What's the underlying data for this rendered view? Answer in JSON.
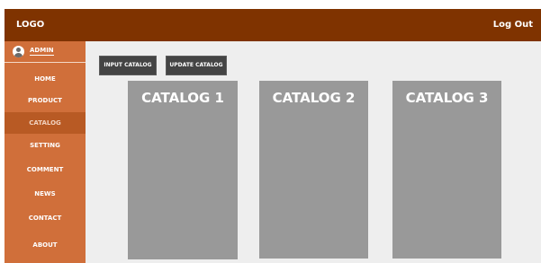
{
  "header": {
    "logo": "LOGO",
    "logout": "Log Out"
  },
  "sidebar": {
    "admin_label": "ADMIN",
    "items": [
      {
        "label": "HOME"
      },
      {
        "label": "PRODUCT"
      },
      {
        "label": "CATALOG",
        "active": true
      },
      {
        "label": "SETTING"
      },
      {
        "label": "COMMENT"
      },
      {
        "label": "NEWS"
      },
      {
        "label": "CONTACT"
      },
      {
        "label": "ABOUT"
      }
    ]
  },
  "main": {
    "buttons": {
      "input": "INPUT CATALOG",
      "update": "UPDATE CATALOG"
    },
    "cards": [
      {
        "title": "CATALOG 1"
      },
      {
        "title": "CATALOG 2"
      },
      {
        "title": "CATALOG 3"
      }
    ]
  },
  "colors": {
    "header": "#7f3300",
    "sidebar": "#d06f3a",
    "sidebar_active": "#b85a24",
    "main_bg": "#eeeeee",
    "button": "#444444",
    "card": "#999999"
  }
}
